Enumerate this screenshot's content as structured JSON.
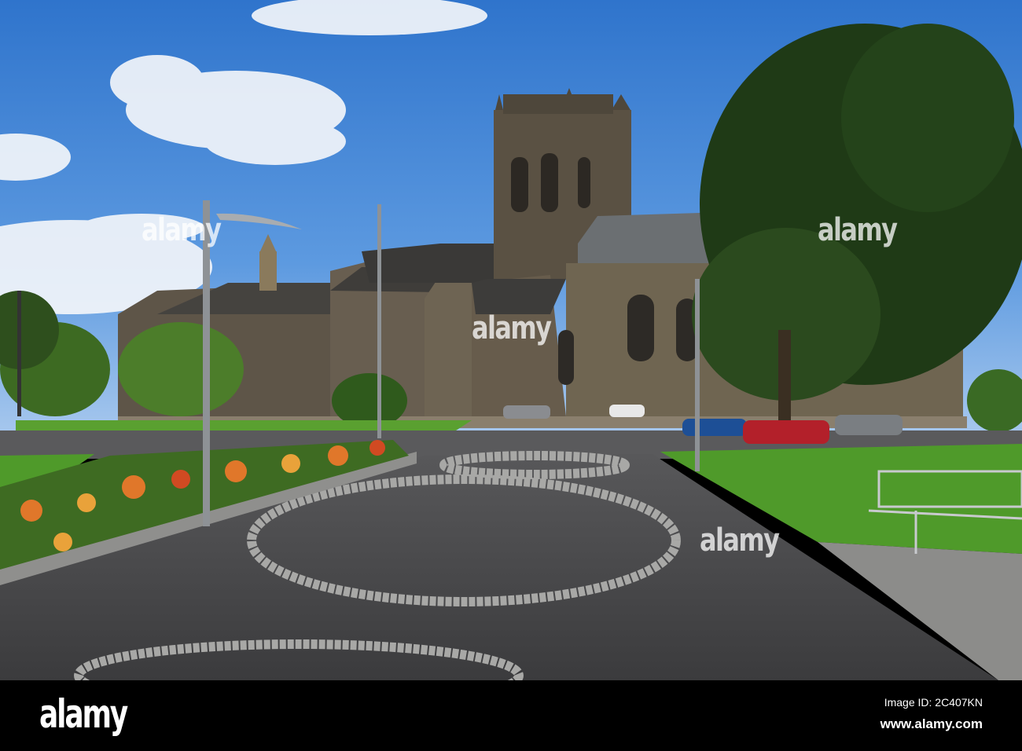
{
  "photo": {
    "subject": "Abbey church with tower, stone buildings, park path with cobbled circles, bench and street lamps"
  },
  "watermarks": [
    "alamy",
    "alamy",
    "alamy",
    "alamy"
  ],
  "footer": {
    "logo": "alamy",
    "image_id": "Image ID: 2C407KN",
    "url": "www.alamy.com"
  },
  "colors": {
    "sky": "#3a7fd0",
    "grass": "#4f9a2a",
    "stone": "#5e5548",
    "asphalt": "#4a4a4c"
  }
}
